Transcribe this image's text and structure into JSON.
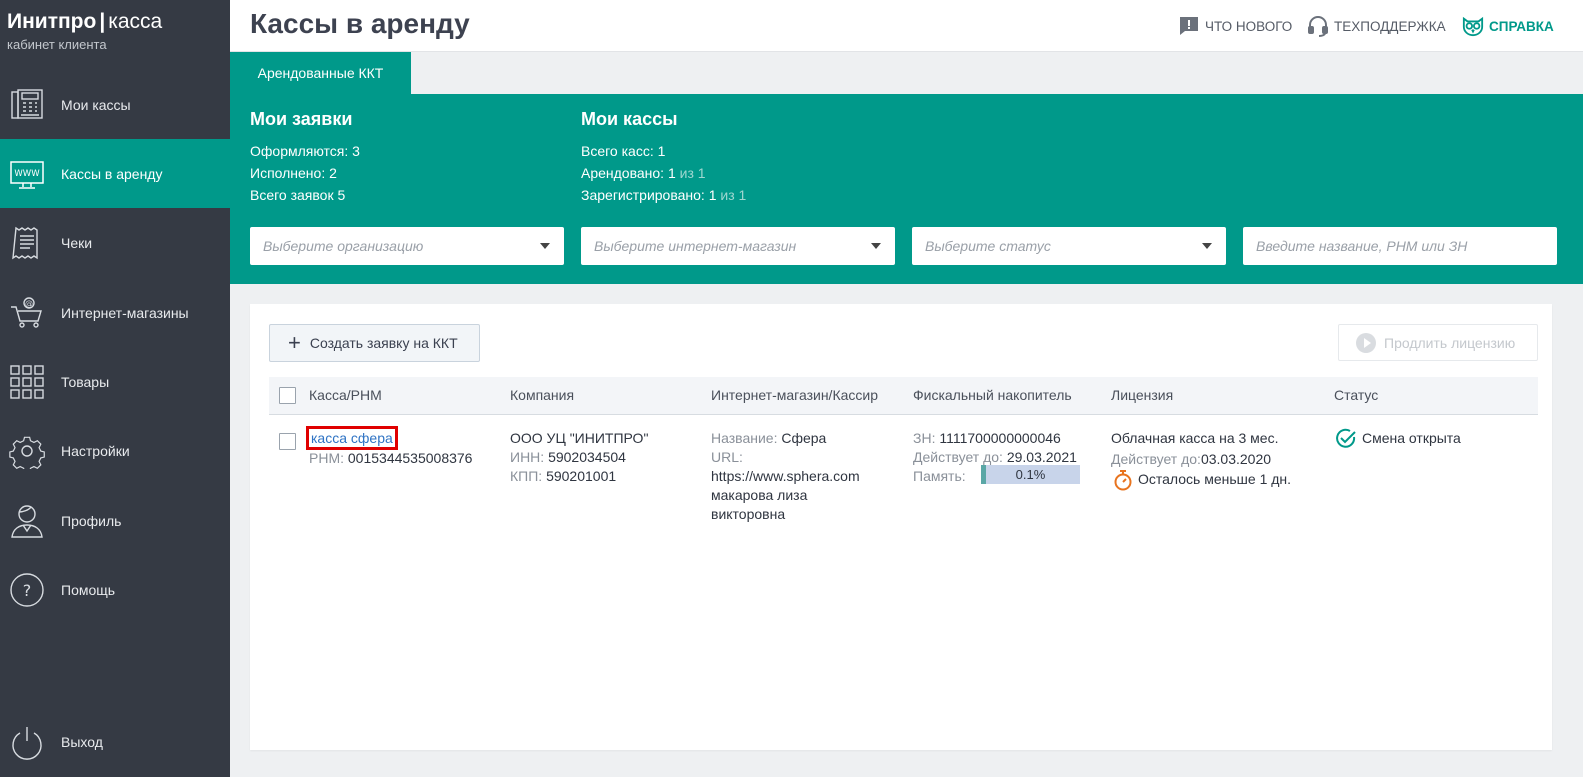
{
  "brand": {
    "name": "Инитпро",
    "product": "касса",
    "subtitle": "кабинет клиента"
  },
  "sidebar": {
    "items": [
      {
        "label": "Мои кассы",
        "icon": "cash-register-icon"
      },
      {
        "label": "Кассы в аренду",
        "icon": "www-monitor-icon",
        "active": true
      },
      {
        "label": "Чеки",
        "icon": "receipt-icon"
      },
      {
        "label": "Интернет-магазины",
        "icon": "cart-icon"
      },
      {
        "label": "Товары",
        "icon": "grid-icon"
      },
      {
        "label": "Настройки",
        "icon": "gear-icon"
      },
      {
        "label": "Профиль",
        "icon": "user-icon"
      },
      {
        "label": "Помощь",
        "icon": "help-circle-icon"
      }
    ],
    "exit_label": "Выход"
  },
  "header": {
    "title": "Кассы в аренду",
    "whats_new": "Что нового",
    "support": "Техподдержка",
    "help": "Справка"
  },
  "tabs": {
    "active": "Арендованные ККТ"
  },
  "summary": {
    "requests": {
      "title": "Мои заявки",
      "in_progress_label": "Оформляются:",
      "in_progress": "3",
      "done_label": "Исполнено:",
      "done": "2",
      "total_label": "Всего заявок",
      "total": "5"
    },
    "kkt": {
      "title": "Мои кассы",
      "total_label": "Всего касс:",
      "total": "1",
      "rented_label": "Арендовано:",
      "rented": "1",
      "rented_of": "из 1",
      "registered_label": "Зарегистрировано:",
      "registered": "1",
      "registered_of": "из 1"
    }
  },
  "filters": {
    "organization": "Выберите организацию",
    "shop": "Выберите интернет-магазин",
    "status": "Выберите статус",
    "search_placeholder": "Введите название, РНМ или ЗН"
  },
  "actions": {
    "create": "Создать заявку на ККТ",
    "renew": "Продлить лицензию"
  },
  "table": {
    "columns": [
      "Касса/РНМ",
      "Компания",
      "Интернет-магазин/Кассир",
      "Фискальный накопитель",
      "Лицензия",
      "Статус"
    ],
    "rows": [
      {
        "kkt_name": "касса сфера",
        "rnm_label": "РНМ:",
        "rnm": "0015344535008376",
        "company": "ООО УЦ \"ИНИТПРО\"",
        "inn_label": "ИНН:",
        "inn": "5902034504",
        "kpp_label": "КПП:",
        "kpp": "590201001",
        "shop_name_label": "Название:",
        "shop_name": "Сфера",
        "url_label": "URL:",
        "url": "https://www.sphera.com",
        "cashier_line1": "макарова лиза",
        "cashier_line2": "викторовна",
        "fn_label": "ЗН:",
        "fn": "1111700000000046",
        "fn_valid_label": "Действует до:",
        "fn_valid": "29.03.2021",
        "memory_label": "Память:",
        "memory": "0.1%",
        "memory_fraction": 0.001,
        "license": "Облачная касса на 3 мес.",
        "license_valid_label": "Действует до:",
        "license_valid": "03.03.2020",
        "license_warning": "Осталось меньше 1 дн.",
        "status": "Смена открыта"
      }
    ]
  },
  "colors": {
    "accent": "#00998a",
    "sidebar": "#353a44",
    "link": "#2f73c4",
    "warning": "#e8741f"
  }
}
